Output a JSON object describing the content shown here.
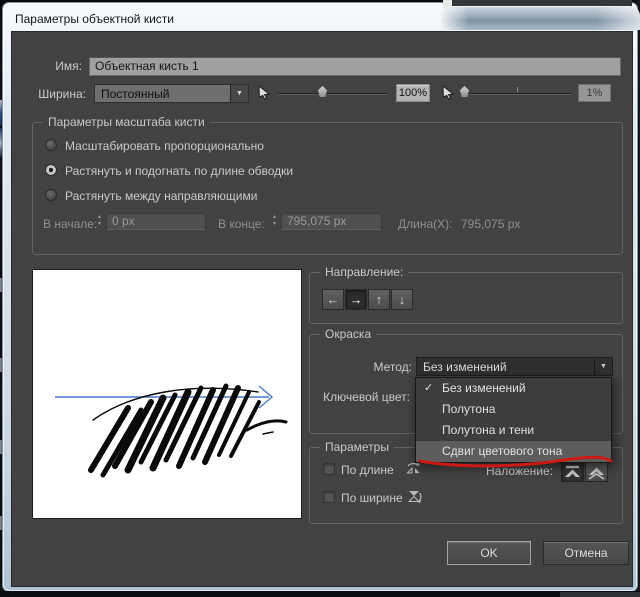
{
  "window": {
    "title": "Параметры объектной кисти"
  },
  "name_row": {
    "label": "Имя:",
    "value": "Объектная кисть 1"
  },
  "width_row": {
    "label": "Ширина:",
    "profile_value": "Постоянный",
    "fixed_value": "100%",
    "variation_value": "1%"
  },
  "scale_group": {
    "title": "Параметры масштаба кисти",
    "options": [
      {
        "label": "Масштабировать пропорционально",
        "selected": false
      },
      {
        "label": "Растянуть и подогнать по длине обводки",
        "selected": true
      },
      {
        "label": "Растянуть между направляющими",
        "selected": false
      }
    ],
    "start_label": "В начале:",
    "start_value": "0 px",
    "end_label": "В конце:",
    "end_value": "795,075 px",
    "length_label": "Длина(X):",
    "length_value": "795,075 px"
  },
  "direction_group": {
    "title": "Направление:",
    "buttons": [
      "←",
      "→",
      "↑",
      "↓"
    ],
    "selected_index": 1
  },
  "color_group": {
    "title": "Окраска",
    "method_label": "Метод:",
    "method_value": "Без изменений",
    "key_color_label": "Ключевой цвет:",
    "dropdown_items": [
      {
        "label": "Без изменений",
        "checked": true
      },
      {
        "label": "Полутона",
        "checked": false
      },
      {
        "label": "Полутона и тени",
        "checked": false
      },
      {
        "label": "Сдвиг цветового тона",
        "checked": false,
        "highlighted": true,
        "annotation": "red-underline"
      }
    ]
  },
  "options_group": {
    "title": "Параметры",
    "flip_length_label": "По длине",
    "flip_width_label": "По ширине",
    "overlap_label": "Наложение:"
  },
  "footer": {
    "ok": "OK",
    "cancel": "Отмена"
  },
  "icons": {
    "dropdown_arrow": "▼",
    "check": "✓",
    "spinner_up": "▴",
    "spinner_down": "▾"
  },
  "colors": {
    "dialog_bg": "#424242",
    "annotation_red": "#cb1a12",
    "preview_arrow_blue": "#4a79c8"
  }
}
